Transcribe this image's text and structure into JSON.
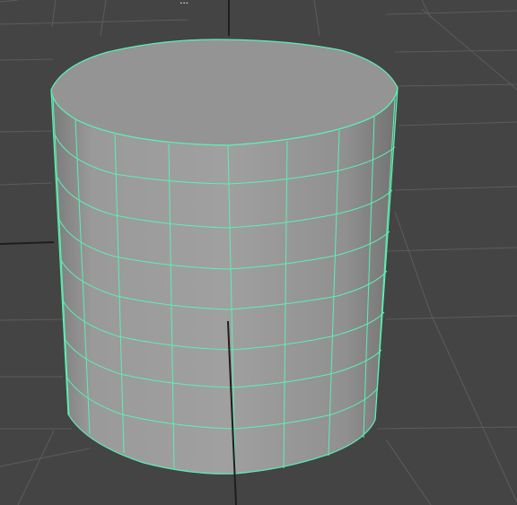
{
  "viewport": {
    "label": "..."
  },
  "colors": {
    "background": "#444444",
    "grid_line": "#5a5a5a",
    "grid_axis": "#1e1e1e",
    "selection_wire": "#5cf0b4",
    "surface_light": "#a3a3a3",
    "surface_dark": "#707070",
    "cap": "#949494"
  },
  "icons": {
    "object": "cylinder-mesh-icon"
  }
}
